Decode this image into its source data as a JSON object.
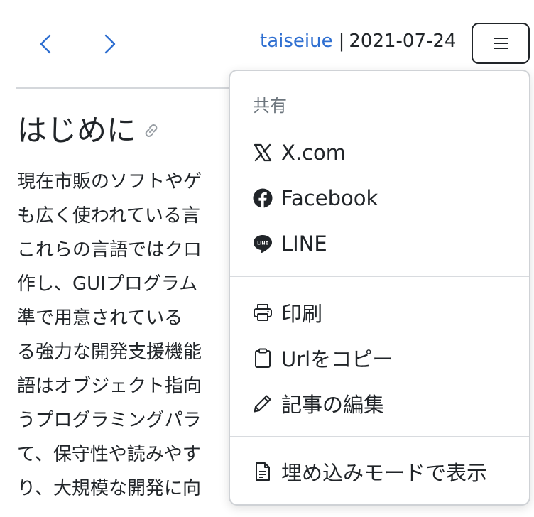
{
  "nav": {
    "prev_icon": "chevron-left-icon",
    "next_icon": "chevron-right-icon",
    "accent_color": "#2f6fd1"
  },
  "meta": {
    "author": "taiseiue",
    "separator": "|",
    "date": "2021-07-24"
  },
  "menu_button": {
    "icon": "hamburger-icon"
  },
  "article": {
    "title": "はじめに",
    "lines": [
      "現在市販のソフトやゲ",
      "も広く使われている言",
      "これらの言語ではクロ",
      "作し、GUIプログラム",
      "準で用意されている",
      "る強力な開発支援機能",
      "語はオブジェクト指向",
      "うプログラミングパラ",
      "て、保守性や読みやす",
      "り、大規模な開発に向"
    ]
  },
  "dropdown": {
    "share_header": "共有",
    "items": [
      {
        "label": "X.com",
        "icon": "x-logo-icon"
      },
      {
        "label": "Facebook",
        "icon": "facebook-icon"
      },
      {
        "label": "LINE",
        "icon": "line-icon"
      },
      {
        "label": "印刷",
        "icon": "printer-icon"
      },
      {
        "label": "Urlをコピー",
        "icon": "clipboard-icon"
      },
      {
        "label": "記事の編集",
        "icon": "pencil-icon"
      },
      {
        "label": "埋め込みモードで表示",
        "icon": "document-icon"
      }
    ]
  }
}
